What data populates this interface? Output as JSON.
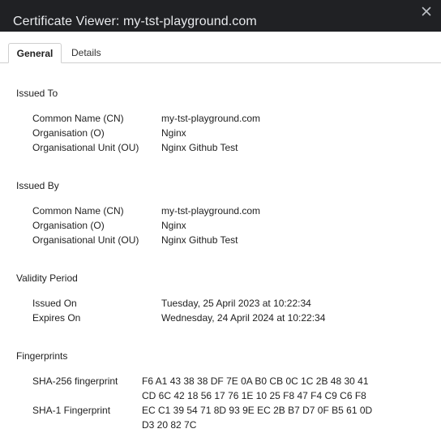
{
  "window": {
    "title": "Certificate Viewer: my-tst-playground.com",
    "close_glyph": "×"
  },
  "tabs": [
    {
      "label": "General",
      "active": true
    },
    {
      "label": "Details",
      "active": false
    }
  ],
  "issued_to": {
    "heading": "Issued To",
    "rows": [
      {
        "label": "Common Name (CN)",
        "value": "my-tst-playground.com"
      },
      {
        "label": "Organisation (O)",
        "value": "Nginx"
      },
      {
        "label": "Organisational Unit (OU)",
        "value": "Nginx Github Test"
      }
    ]
  },
  "issued_by": {
    "heading": "Issued By",
    "rows": [
      {
        "label": "Common Name (CN)",
        "value": "my-tst-playground.com"
      },
      {
        "label": "Organisation (O)",
        "value": "Nginx"
      },
      {
        "label": "Organisational Unit (OU)",
        "value": "Nginx Github Test"
      }
    ]
  },
  "validity": {
    "heading": "Validity Period",
    "rows": [
      {
        "label": "Issued On",
        "value": "Tuesday, 25 April 2023 at 10:22:34"
      },
      {
        "label": "Expires On",
        "value": "Wednesday, 24 April 2024 at 10:22:34"
      }
    ]
  },
  "fingerprints": {
    "heading": "Fingerprints",
    "sha256": {
      "label": "SHA-256 fingerprint",
      "lines": [
        "F6 A1 43 38 38 DF 7E 0A B0 CB 0C 1C 2B 48 30 41",
        "CD 6C 42 18 56 17 76 1E 10 25 F8 47 F4 C9 C6 F8"
      ]
    },
    "sha1": {
      "label": "SHA-1 Fingerprint",
      "lines": [
        "EC C1 39 54 71 8D 93 9E EC 2B B7 D7 0F B5 61 0D",
        "D3 20 82 7C"
      ]
    }
  },
  "colors": {
    "titlebar_bg": "#202124",
    "titlebar_text": "#e8eaed",
    "page_bg": "#ffffff",
    "text": "#1f1f1f",
    "divider": "#cfcfcf"
  },
  "icons": {
    "close": "close-icon"
  }
}
